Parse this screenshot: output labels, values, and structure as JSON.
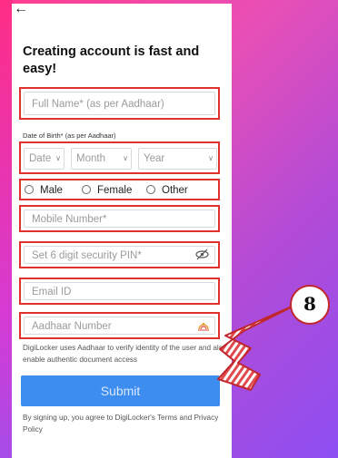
{
  "header": {
    "back_icon": "arrow-left-icon",
    "back_glyph": "←"
  },
  "title": "Creating account is fast and easy!",
  "full_name": {
    "placeholder": "Full Name* (as per Aadhaar)"
  },
  "dob": {
    "label": "Date of Birth* (as per Aadhaar)",
    "date": "Date",
    "month": "Month",
    "year": "Year"
  },
  "gender": {
    "options": [
      "Male",
      "Female",
      "Other"
    ]
  },
  "mobile": {
    "placeholder": "Mobile Number*"
  },
  "pin": {
    "placeholder": "Set 6 digit security PIN*",
    "icon": "eye-hidden-icon"
  },
  "email": {
    "placeholder": "Email ID"
  },
  "aadhaar": {
    "placeholder": "Aadhaar Number",
    "icon": "aadhaar-logo-icon"
  },
  "note": "DigiLocker uses Aadhaar to verify identity of the user and also enable authentic document access",
  "submit_label": "Submit",
  "terms": "By signing up, you agree to DigiLocker's Terms and Privacy Policy",
  "annotation": {
    "step_number": "8"
  },
  "colors": {
    "highlight": "#e0322d",
    "submit_bg": "#3d8df0",
    "background_start": "#ff3d8f",
    "background_end": "#8d4ff2"
  }
}
